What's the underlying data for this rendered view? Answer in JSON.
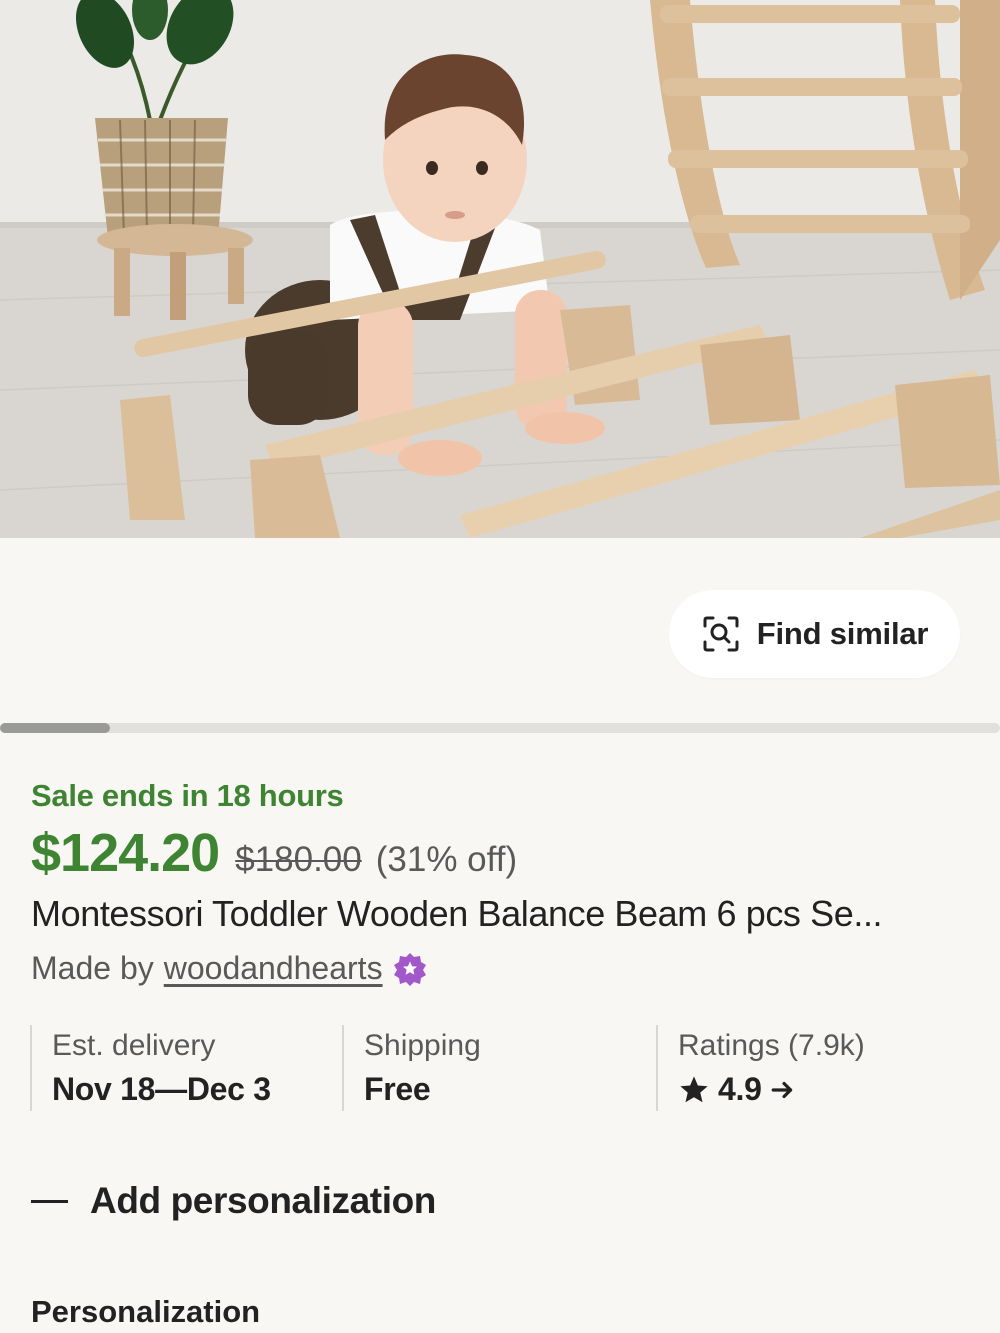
{
  "hero_image": {
    "description_icon": "product-photo"
  },
  "find_similar": {
    "label": "Find similar",
    "icon": "image-search-icon"
  },
  "carousel": {
    "progress": 0.11
  },
  "sale": {
    "ends_label": "Sale ends in 18 hours",
    "price": "$124.20",
    "original_price": "$180.00",
    "discount": "(31% off)",
    "accent_color": "#3e8433"
  },
  "product": {
    "title": "Montessori Toddler Wooden Balance Beam 6 pcs Se...",
    "made_by_prefix": "Made by",
    "seller": "woodandhearts",
    "seller_badge_icon": "star-seller-icon",
    "badge_color": "#a158c8"
  },
  "info": {
    "delivery_label": "Est. delivery",
    "delivery_value": "Nov 18—Dec 3",
    "shipping_label": "Shipping",
    "shipping_value": "Free",
    "ratings_label": "Ratings (7.9k)",
    "ratings_value": "4.9"
  },
  "personalization": {
    "toggle_label": "Add personalization",
    "heading": "Personalization"
  }
}
